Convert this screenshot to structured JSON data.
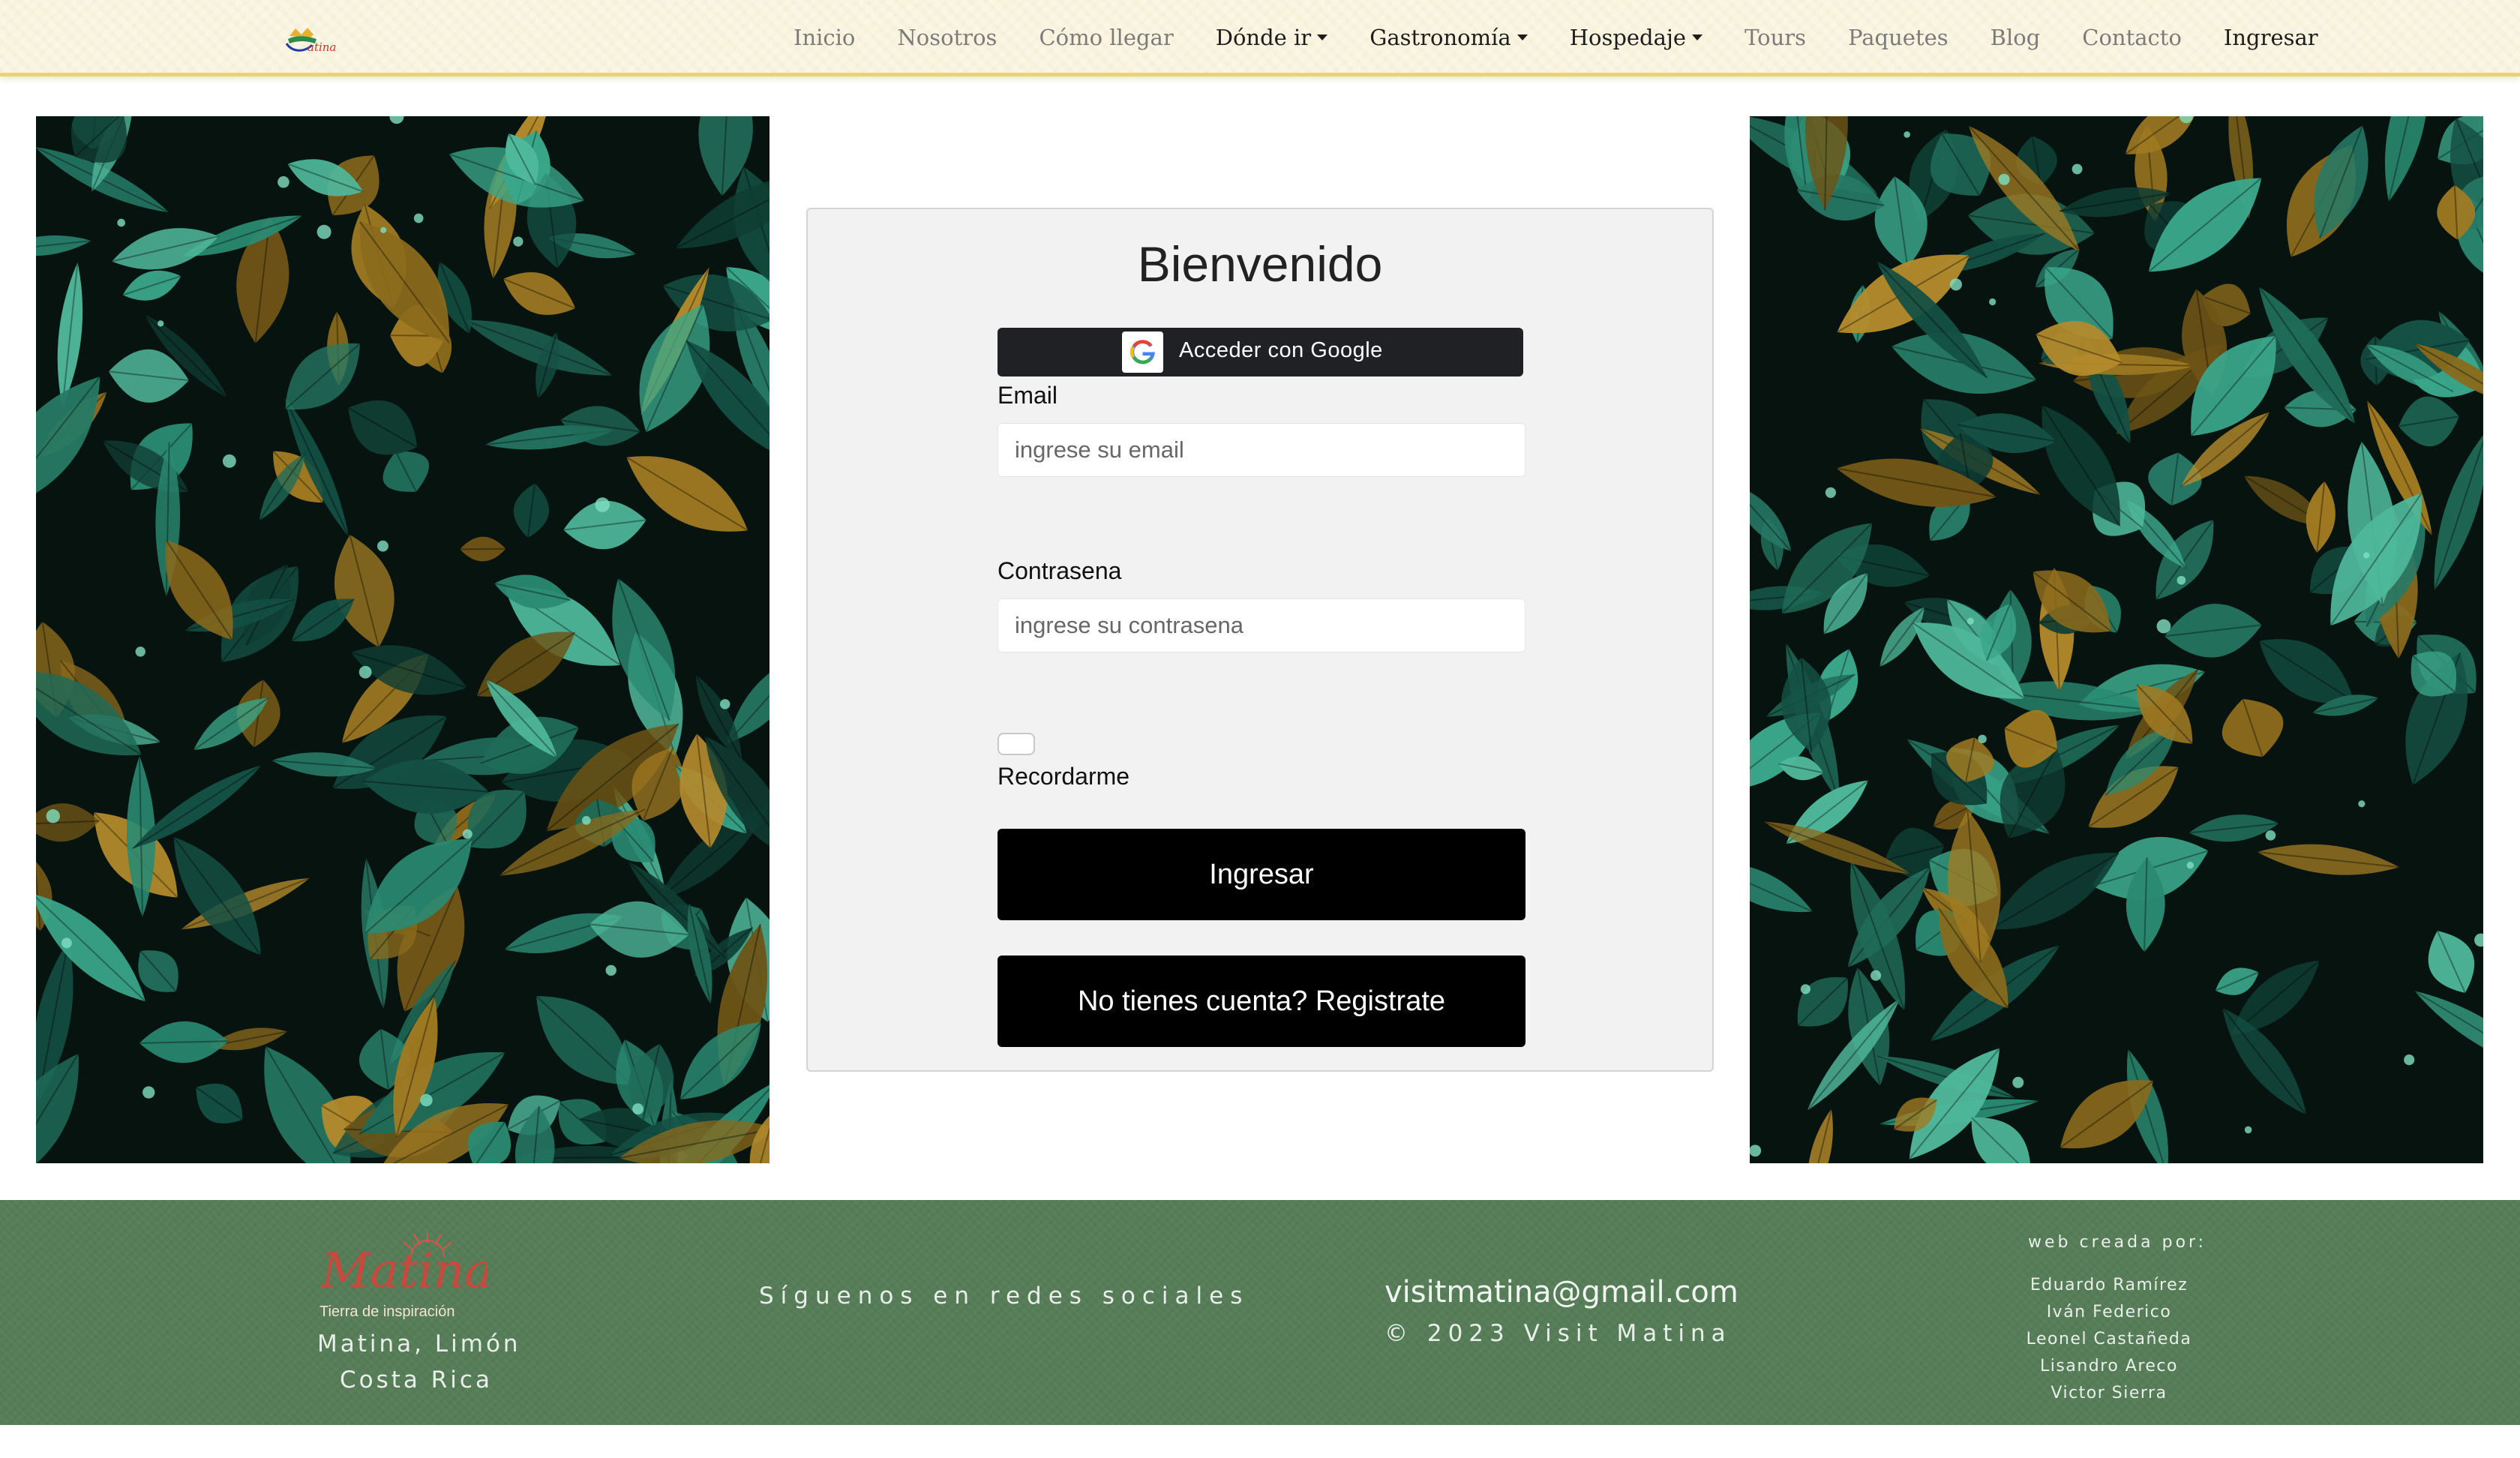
{
  "navbar": {
    "logo_text": "Matina",
    "items": [
      {
        "label": "Inicio",
        "dropdown": false,
        "emphasis": false
      },
      {
        "label": "Nosotros",
        "dropdown": false,
        "emphasis": false
      },
      {
        "label": "Cómo llegar",
        "dropdown": false,
        "emphasis": false
      },
      {
        "label": "Dónde ir",
        "dropdown": true,
        "emphasis": true
      },
      {
        "label": "Gastronomía",
        "dropdown": true,
        "emphasis": true
      },
      {
        "label": "Hospedaje",
        "dropdown": true,
        "emphasis": true
      },
      {
        "label": "Tours",
        "dropdown": false,
        "emphasis": false
      },
      {
        "label": "Paquetes",
        "dropdown": false,
        "emphasis": false
      },
      {
        "label": "Blog",
        "dropdown": false,
        "emphasis": false
      },
      {
        "label": "Contacto",
        "dropdown": false,
        "emphasis": false
      },
      {
        "label": "Ingresar",
        "dropdown": false,
        "emphasis": true
      }
    ]
  },
  "login": {
    "title": "Bienvenido",
    "google_button": "Acceder con Google",
    "email_label": "Email",
    "email_placeholder": "ingrese su email",
    "password_label": "Contrasena",
    "password_placeholder": "ingrese su contrasena",
    "remember_label": "Recordarme",
    "submit_button": "Ingresar",
    "register_button": "No tienes cuenta? Registrate"
  },
  "footer": {
    "logo_text": "Matina",
    "tagline": "Tierra de inspiración",
    "location_line1": "Matina, Limón",
    "location_line2": "Costa Rica",
    "social_text": "Síguenos en redes sociales",
    "email": "visitmatina@gmail.com",
    "copyright": "© 2023 Visit Matina",
    "credits_heading": "web creada por:",
    "credits": [
      "Eduardo Ramírez",
      "Iván Federico",
      "Leonel Castañeda",
      "Lisandro Areco",
      "Victor Sierra"
    ]
  },
  "colors": {
    "navbar_bg": "#fbf6e3",
    "navbar_border": "#f0cf77",
    "footer_bg": "#567d58",
    "button_bg": "#000000",
    "google_button_bg": "#202124",
    "card_bg": "#f2f2f2"
  },
  "icons": {
    "google": "google-g-icon",
    "dropdown": "caret-down-icon"
  }
}
